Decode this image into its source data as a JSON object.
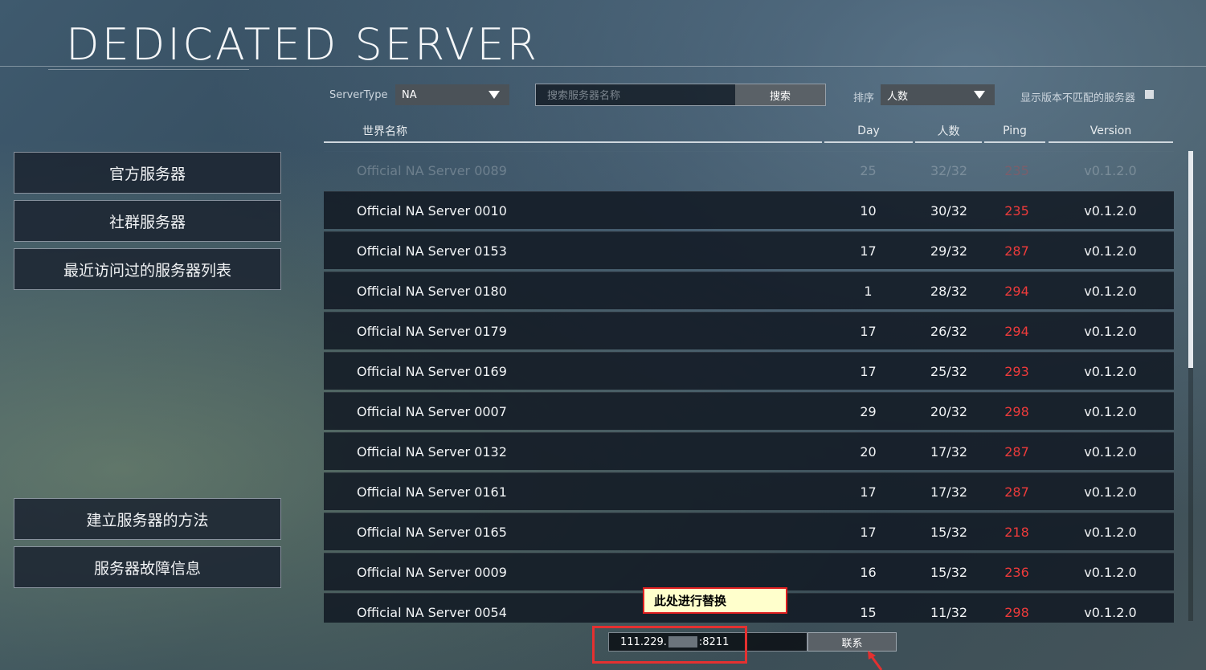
{
  "header": {
    "title": "DEDICATED SERVER"
  },
  "sidebar": {
    "top_items": [
      "官方服务器",
      "社群服务器",
      "最近访问过的服务器列表"
    ],
    "bottom_items": [
      "建立服务器的方法",
      "服务器故障信息"
    ]
  },
  "filters": {
    "server_type_label": "ServerType",
    "server_type_value": "NA",
    "search_placeholder": "搜索服务器名称",
    "search_button": "搜索",
    "sort_label": "排序",
    "sort_value": "人数",
    "show_mismatch_label": "显示版本不匹配的服务器"
  },
  "table": {
    "columns": {
      "name": "世界名称",
      "day": "Day",
      "players": "人数",
      "ping": "Ping",
      "version": "Version"
    },
    "rows": [
      {
        "name": "Official NA Server 0089",
        "day": "25",
        "players": "32/32",
        "ping": "235",
        "version": "v0.1.2.0"
      },
      {
        "name": "Official NA Server 0010",
        "day": "10",
        "players": "30/32",
        "ping": "235",
        "version": "v0.1.2.0"
      },
      {
        "name": "Official NA Server 0153",
        "day": "17",
        "players": "29/32",
        "ping": "287",
        "version": "v0.1.2.0"
      },
      {
        "name": "Official NA Server 0180",
        "day": "1",
        "players": "28/32",
        "ping": "294",
        "version": "v0.1.2.0"
      },
      {
        "name": "Official NA Server 0179",
        "day": "17",
        "players": "26/32",
        "ping": "294",
        "version": "v0.1.2.0"
      },
      {
        "name": "Official NA Server 0169",
        "day": "17",
        "players": "25/32",
        "ping": "293",
        "version": "v0.1.2.0"
      },
      {
        "name": "Official NA Server 0007",
        "day": "29",
        "players": "20/32",
        "ping": "298",
        "version": "v0.1.2.0"
      },
      {
        "name": "Official NA Server 0132",
        "day": "20",
        "players": "17/32",
        "ping": "287",
        "version": "v0.1.2.0"
      },
      {
        "name": "Official NA Server 0161",
        "day": "17",
        "players": "17/32",
        "ping": "287",
        "version": "v0.1.2.0"
      },
      {
        "name": "Official NA Server 0165",
        "day": "17",
        "players": "15/32",
        "ping": "218",
        "version": "v0.1.2.0"
      },
      {
        "name": "Official NA Server 0009",
        "day": "16",
        "players": "15/32",
        "ping": "236",
        "version": "v0.1.2.0"
      },
      {
        "name": "Official NA Server 0054",
        "day": "15",
        "players": "11/32",
        "ping": "298",
        "version": "v0.1.2.0"
      }
    ]
  },
  "connect": {
    "ip_prefix": "111.229.",
    "ip_suffix": ":8211",
    "button": "联系",
    "annotation": "此处进行替换"
  },
  "colors": {
    "ping": "#ee3b3b",
    "annotation_border": "#e02020",
    "annotation_bg": "#ffffcc"
  }
}
